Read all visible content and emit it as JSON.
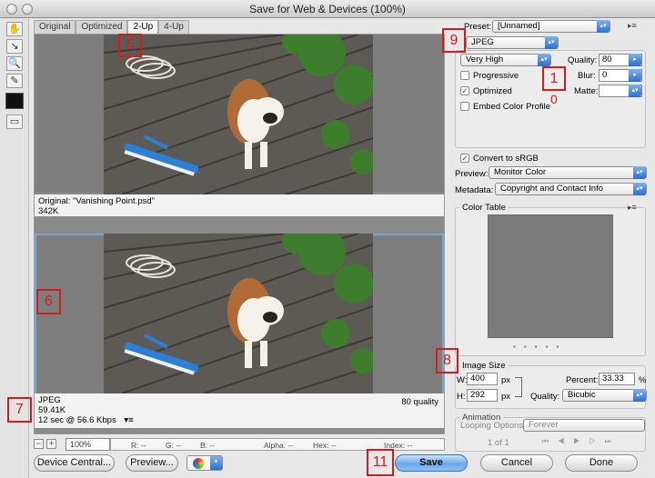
{
  "window": {
    "title": "Save for Web & Devices (100%)"
  },
  "tabs": [
    {
      "label": "Original"
    },
    {
      "label": "Optimized"
    },
    {
      "label": "2-Up"
    },
    {
      "label": "4-Up"
    }
  ],
  "tools": [
    "hand-tool",
    "slice-select-tool",
    "zoom-tool",
    "eyedropper-tool"
  ],
  "original_pane": {
    "caption": "Original: \"Vanishing Point.psd\"",
    "size": "342K"
  },
  "optimized_pane": {
    "format": "JPEG",
    "size": "59.41K",
    "download_time": "12 sec @ 56.6 Kbps",
    "quality_note": "80 quality"
  },
  "status_bar": {
    "zoom": "100%",
    "r": "R: --",
    "g": "G: --",
    "b": "B: --",
    "alpha": "Alpha: --",
    "hex": "Hex: --",
    "index": "Index: --"
  },
  "buttons": {
    "device_central": "Device Central...",
    "preview": "Preview...",
    "save": "Save",
    "cancel": "Cancel",
    "done": "Done"
  },
  "settings": {
    "preset_label": "Preset:",
    "preset_value": "[Unnamed]",
    "format_value": "JPEG",
    "quality_preset": "Very High",
    "quality_label": "Quality:",
    "quality_value": "80",
    "blur_label": "Blur:",
    "blur_value": "0",
    "matte_label": "Matte:",
    "progressive_label": "Progressive",
    "progressive_checked": false,
    "optimized_label": "Optimized",
    "optimized_checked": true,
    "embed_label": "Embed Color Profile",
    "embed_checked": false,
    "convert_label": "Convert to sRGB",
    "convert_checked": true,
    "preview_label": "Preview:",
    "preview_value": "Monitor Color",
    "metadata_label": "Metadata:",
    "metadata_value": "Copyright and Contact Info"
  },
  "color_table": {
    "title": "Color Table"
  },
  "image_size": {
    "title": "Image Size",
    "w_label": "W:",
    "w_value": "400",
    "h_label": "H:",
    "h_value": "292",
    "unit": "px",
    "percent_label": "Percent:",
    "percent_value": "33.33",
    "percent_unit": "%",
    "quality_label": "Quality:",
    "quality_value": "Bicubic"
  },
  "animation": {
    "title": "Animation",
    "looping_label": "Looping Options:",
    "looping_value": "Forever",
    "frame_counter": "1 of 1"
  },
  "annotations": {
    "m1": "1",
    "m0": "0",
    "m5": "5",
    "m6": "6",
    "m7": "7",
    "m8": "8",
    "m9": "9",
    "m11": "11"
  },
  "colors": {
    "accent": "#2b6dd1",
    "marker": "#d71a1a",
    "selection": "#7aa7d8"
  }
}
